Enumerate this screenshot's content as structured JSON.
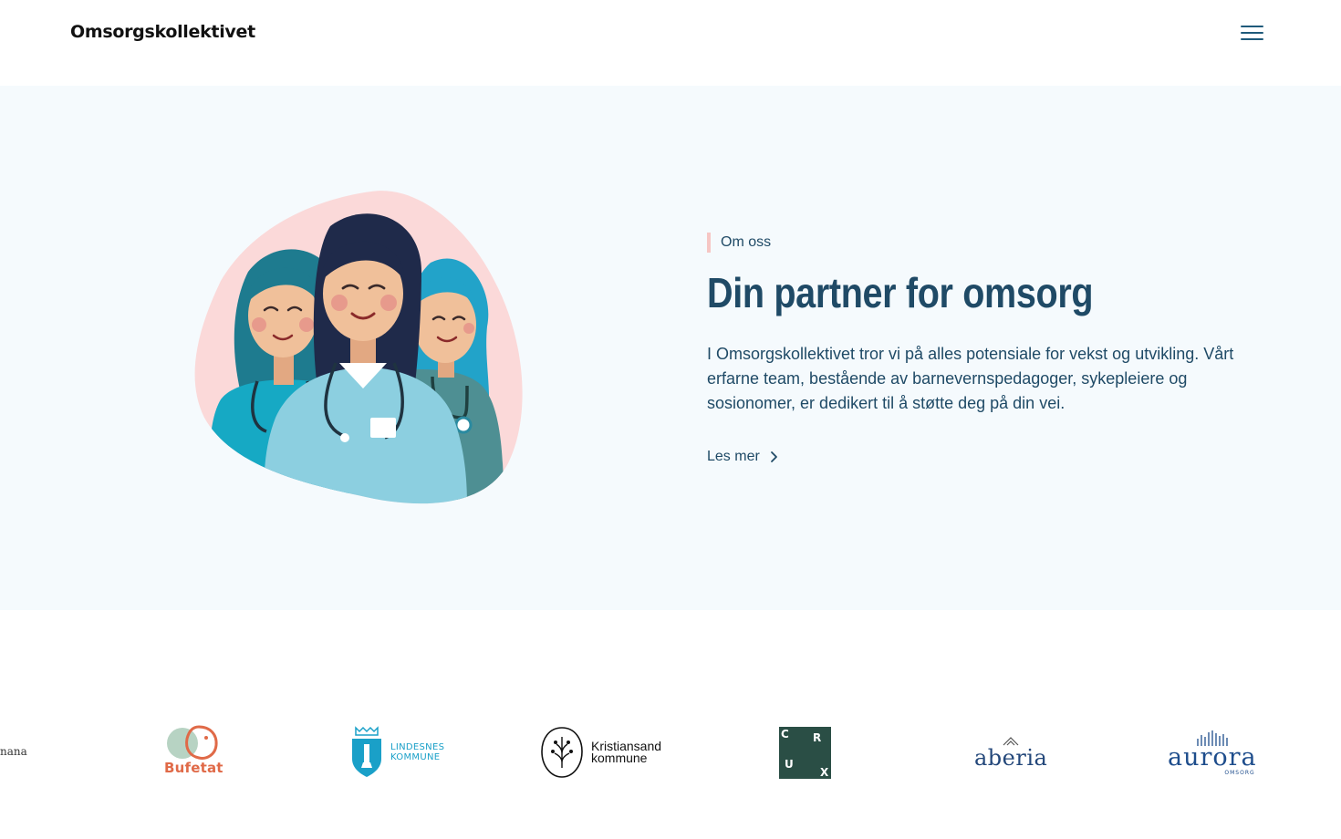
{
  "header": {
    "brand": "Omsorgskollektivet",
    "menu_icon": "hamburger-menu-icon"
  },
  "hero": {
    "eyebrow": "Om oss",
    "headline": "Din partner for omsorg",
    "body": "I Omsorgskollektivet tror vi på alles potensiale for vekst og utvikling. Vårt erfarne team, bestående av barnevernspedagoger, sykepleiere og sosionomer, er dedikert til å støtte deg på din vei.",
    "cta_label": "Les mer",
    "cta_icon": "chevron-right-icon"
  },
  "logos": {
    "manana": "nana",
    "bufetat": "Bufetat",
    "lindesnes_line1": "LINDESNES",
    "lindesnes_line2": "KOMMUNE",
    "kristiansand_line1": "Kristiansand",
    "kristiansand_line2": "kommune",
    "crux": [
      "C",
      "R",
      "U",
      "X"
    ],
    "aberia": "aberia",
    "aurora": "aurora",
    "aurora_sub": "OMSORG"
  },
  "colors": {
    "navy": "#1f4a66",
    "hero_bg": "#f5fafd",
    "accent_pink": "#f6c6c4",
    "blob_pink": "#fbd9d9"
  }
}
